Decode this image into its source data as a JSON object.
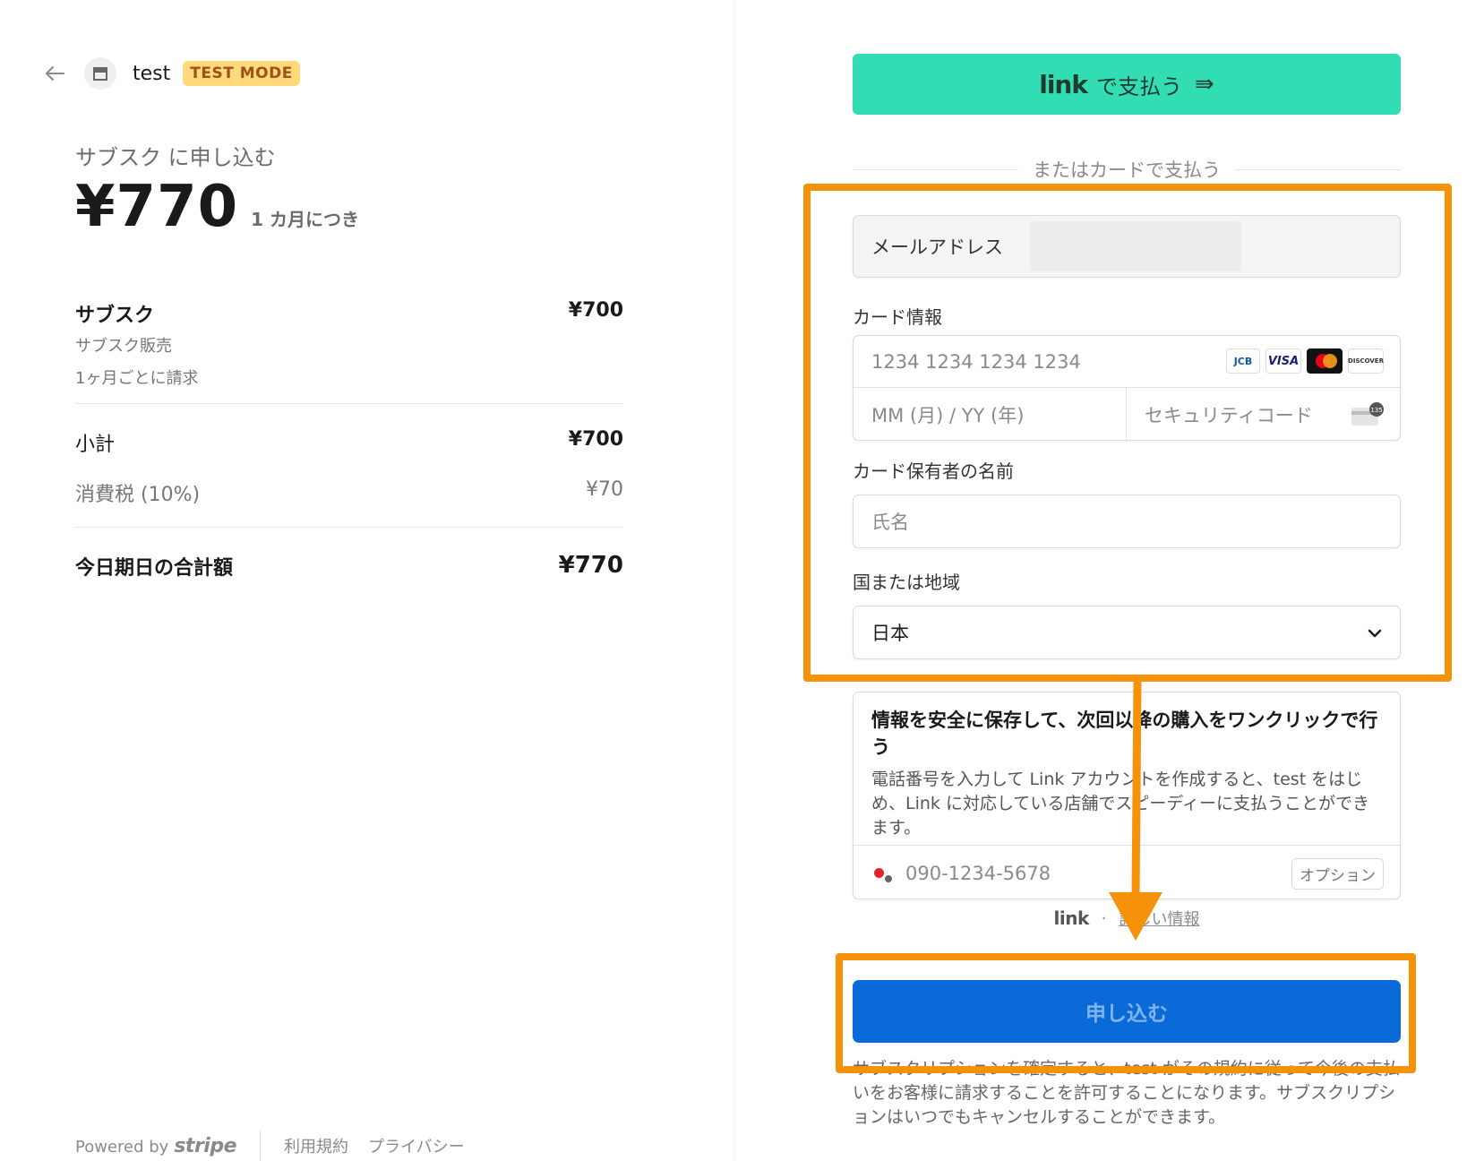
{
  "header": {
    "merchant_name": "test",
    "test_mode_badge": "TEST MODE"
  },
  "summary": {
    "subscribe_title": "サブスク に申し込む",
    "price": "¥770",
    "period": "1 カ月につき"
  },
  "line_item": {
    "name": "サブスク",
    "description": "サブスク販売",
    "billing": "1ヶ月ごとに請求",
    "price": "¥700"
  },
  "totals": {
    "subtotal_label": "小計",
    "subtotal_value": "¥700",
    "tax_label": "消費税 (10%)",
    "tax_value": "¥70",
    "total_label": "今日期日の合計額",
    "total_value": "¥770"
  },
  "footer": {
    "powered_by": "Powered by",
    "stripe": "stripe",
    "terms": "利用規約",
    "privacy": "プライバシー"
  },
  "payment": {
    "link_logo": "link",
    "link_pay": "で支払う",
    "link_arrow": "⇛",
    "or_card": "またはカードで支払う",
    "email_label": "メールアドレス",
    "card_info_label": "カード情報",
    "card_number_placeholder": "1234 1234 1234 1234",
    "card_brands": [
      "JCB",
      "VISA",
      "Mastercard",
      "DISCOVER"
    ],
    "expiry_placeholder": "MM (月) / YY (年)",
    "cvc_placeholder": "セキュリティコード",
    "cvc_icon_digits": "135",
    "cardholder_label": "カード保有者の名前",
    "cardholder_placeholder": "氏名",
    "country_label": "国または地域",
    "country_value": "日本"
  },
  "link_save": {
    "title": "情報を安全に保存して、次回以降の購入をワンクリックで行う",
    "description": "電話番号を入力して Link アカウントを作成すると、test をはじめ、Link に対応している店舗でスピーディーに支払うことができます。",
    "phone_placeholder": "090-1234-5678",
    "optional_badge": "オプション",
    "footer_link": "link",
    "footer_dot": "·",
    "footer_more": "詳しい情報"
  },
  "submit": {
    "label": "申し込む",
    "terms": "サブスクリプションを確定すると、test がその規約に従って今後の支払いをお客様に請求することを許可することになります。サブスクリプションはいつでもキャンセルすることができます。"
  },
  "colors": {
    "link_green": "#33ddb3",
    "submit_blue": "#0a6ad8",
    "annotation_orange": "#f5920a",
    "test_badge_bg": "#ffd97a"
  }
}
